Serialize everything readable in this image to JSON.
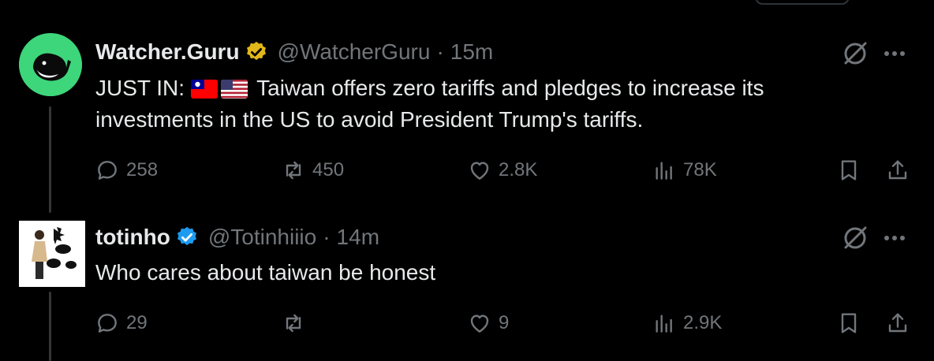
{
  "tweets": [
    {
      "name": "Watcher.Guru",
      "handle": "@WatcherGuru",
      "separator": "·",
      "time": "15m",
      "badge": "gold-verified",
      "text_prefix": "JUST IN:",
      "flags": [
        "taiwan-flag",
        "us-flag"
      ],
      "text_line1": "Taiwan offers zero tariffs and pledges to increase its",
      "text_line2": "investments in the US to avoid President Trump's tariffs.",
      "replies": "258",
      "retweets": "450",
      "likes": "2.8K",
      "views": "78K"
    },
    {
      "name": "totinho",
      "handle": "@Totinhiiio",
      "separator": "·",
      "time": "14m",
      "badge": "blue-verified",
      "text": "Who cares about taiwan be honest",
      "replies": "29",
      "retweets": "",
      "likes": "9",
      "views": "2.9K"
    }
  ],
  "colors": {
    "background": "#000000",
    "text": "#e7e9ea",
    "muted": "#71767b",
    "gold": "#e2b719",
    "blue": "#1d9bf0",
    "watcher_green": "#3dd67b"
  }
}
